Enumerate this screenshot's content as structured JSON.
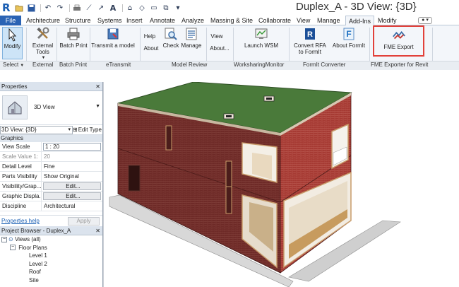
{
  "window": {
    "title": "Duplex_A - 3D View: {3D}",
    "app_logo": "R"
  },
  "qat": {
    "icons": [
      "open-icon",
      "save-icon",
      "undo-icon",
      "redo-icon",
      "print-icon",
      "measure-icon",
      "text-icon",
      "view-3d-icon",
      "thin-lines-icon",
      "close-views-icon"
    ]
  },
  "tabs": {
    "file": "File",
    "items": [
      "Architecture",
      "Structure",
      "Systems",
      "Insert",
      "Annotate",
      "Analyze",
      "Massing & Site",
      "Collaborate",
      "View",
      "Manage",
      "Add-Ins",
      "Modify"
    ],
    "active": "Add-Ins"
  },
  "ribbon": {
    "modify": "Modify",
    "external_tools": "External Tools",
    "batch_print": "Batch Print",
    "transmit_model": "Transmit a model",
    "help": "Help",
    "about": "About",
    "check": "Check",
    "manage": "Manage",
    "view": "View",
    "about_ellipsis": "About...",
    "launch_wsm": "Launch WSM",
    "convert_rfa": "Convert RFA to FormIt",
    "about_formit": "About FormIt",
    "fme_export": "FME Export",
    "groups": {
      "select": "Select",
      "external": "External",
      "batch_print": "Batch Print",
      "etransmit": "eTransmit",
      "model_review": "Model Review",
      "worksharing": "WorksharingMonitor",
      "formit": "FormIt Converter",
      "fme": "FME Exporter for Revit"
    }
  },
  "properties": {
    "title": "Properties",
    "type_name": "3D View",
    "instance": "3D View: {3D}",
    "edit_type": "Edit Type",
    "category": "Graphics",
    "rows": [
      {
        "name": "View Scale",
        "value": "1 : 20"
      },
      {
        "name": "Scale Value   1:",
        "value": "20"
      },
      {
        "name": "Detail Level",
        "value": "Fine"
      },
      {
        "name": "Parts Visibility",
        "value": "Show Original"
      },
      {
        "name": "Visibility/Grap...",
        "value": "Edit..."
      },
      {
        "name": "Graphic Displa...",
        "value": "Edit..."
      },
      {
        "name": "Discipline",
        "value": "Architectural"
      }
    ],
    "help_link": "Properties help",
    "apply": "Apply"
  },
  "browser": {
    "title": "Project Browser - Duplex_A",
    "tree": {
      "views": "Views (all)",
      "floor_plans": "Floor Plans",
      "level1": "Level 1",
      "level2": "Level 2",
      "roof": "Roof",
      "site": "Site"
    }
  },
  "colors": {
    "file_tab": "#2a63b4",
    "ribbon_bg": "#f3f6fa",
    "brick": "#7a2e2a",
    "roof": "#4a7a3a",
    "highlight": "#e2413a"
  }
}
